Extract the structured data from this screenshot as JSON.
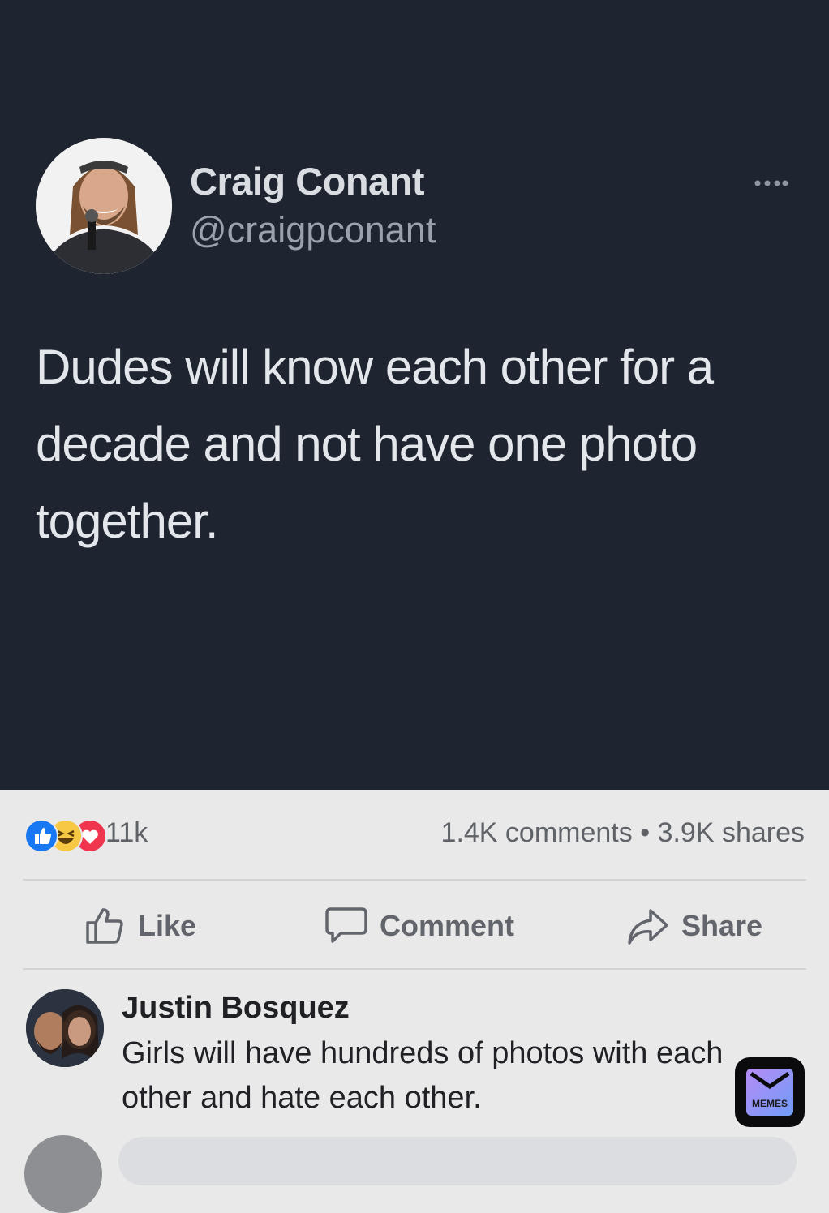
{
  "tweet": {
    "display_name": "Craig Conant",
    "handle": "@craigpconant",
    "text": "Dudes will know each other for a decade and not have one photo together.",
    "more_icon": "more-options-icon"
  },
  "post_stats": {
    "reactions": [
      "like-reaction-icon",
      "haha-reaction-icon",
      "love-reaction-icon"
    ],
    "reaction_count": "11k",
    "comments_shares": "1.4K comments • 3.9K shares"
  },
  "actions": {
    "like_label": "Like",
    "comment_label": "Comment",
    "share_label": "Share"
  },
  "comment": {
    "author": "Justin Bosquez",
    "text": "Girls will have hundreds of photos with each other and hate each other."
  },
  "watermark": {
    "label": "MEMES"
  },
  "colors": {
    "card_bg": "#1e2530",
    "page_bg": "#e9e9ea",
    "like_blue": "#1877f2",
    "love_red": "#f0364f",
    "haha_yellow": "#f7c844"
  }
}
